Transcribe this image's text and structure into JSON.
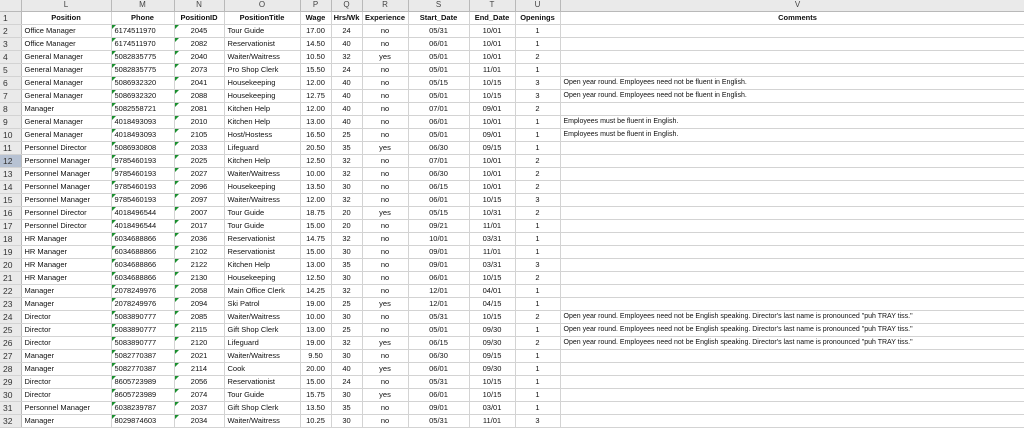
{
  "columns": [
    "L",
    "M",
    "N",
    "O",
    "P",
    "Q",
    "R",
    "S",
    "T",
    "U",
    "V"
  ],
  "headers": [
    "Position",
    "Phone",
    "PositionID",
    "PositionTitle",
    "Wage",
    "Hrs/Wk",
    "Experience",
    "Start_Date",
    "End_Date",
    "Openings",
    "Comments"
  ],
  "selected_row": 12,
  "rows": [
    {
      "num": 2,
      "cells": [
        "Office Manager",
        "6174511970",
        "2045",
        "Tour Guide",
        "17.00",
        "24",
        "no",
        "05/31",
        "10/01",
        "1",
        ""
      ]
    },
    {
      "num": 3,
      "cells": [
        "Office Manager",
        "6174511970",
        "2082",
        "Reservationist",
        "14.50",
        "40",
        "no",
        "06/01",
        "10/01",
        "1",
        ""
      ]
    },
    {
      "num": 4,
      "cells": [
        "General Manager",
        "5082835775",
        "2040",
        "Waiter/Waitress",
        "10.50",
        "32",
        "yes",
        "05/01",
        "10/01",
        "2",
        ""
      ]
    },
    {
      "num": 5,
      "cells": [
        "General Manager",
        "5082835775",
        "2073",
        "Pro Shop Clerk",
        "15.50",
        "24",
        "no",
        "05/01",
        "11/01",
        "1",
        ""
      ]
    },
    {
      "num": 6,
      "cells": [
        "General Manager",
        "5086932320",
        "2041",
        "Housekeeping",
        "12.00",
        "40",
        "no",
        "05/15",
        "10/15",
        "3",
        "Open year round. Employees need not be fluent in English."
      ]
    },
    {
      "num": 7,
      "cells": [
        "General Manager",
        "5086932320",
        "2088",
        "Housekeeping",
        "12.75",
        "40",
        "no",
        "05/01",
        "10/15",
        "3",
        "Open year round. Employees need not be fluent in English."
      ]
    },
    {
      "num": 8,
      "cells": [
        "Manager",
        "5082558721",
        "2081",
        "Kitchen Help",
        "12.00",
        "40",
        "no",
        "07/01",
        "09/01",
        "2",
        ""
      ]
    },
    {
      "num": 9,
      "cells": [
        "General Manager",
        "4018493093",
        "2010",
        "Kitchen Help",
        "13.00",
        "40",
        "no",
        "06/01",
        "10/01",
        "1",
        "Employees must be fluent in English."
      ]
    },
    {
      "num": 10,
      "cells": [
        "General Manager",
        "4018493093",
        "2105",
        "Host/Hostess",
        "16.50",
        "25",
        "no",
        "05/01",
        "09/01",
        "1",
        "Employees must be fluent in English."
      ]
    },
    {
      "num": 11,
      "cells": [
        "Personnel Director",
        "5086930808",
        "2033",
        "Lifeguard",
        "20.50",
        "35",
        "yes",
        "06/30",
        "09/15",
        "1",
        ""
      ]
    },
    {
      "num": 12,
      "cells": [
        "Personnel Manager",
        "9785460193",
        "2025",
        "Kitchen Help",
        "12.50",
        "32",
        "no",
        "07/01",
        "10/01",
        "2",
        ""
      ]
    },
    {
      "num": 13,
      "cells": [
        "Personnel Manager",
        "9785460193",
        "2027",
        "Waiter/Waitress",
        "10.00",
        "32",
        "no",
        "06/30",
        "10/01",
        "2",
        ""
      ]
    },
    {
      "num": 14,
      "cells": [
        "Personnel Manager",
        "9785460193",
        "2096",
        "Housekeeping",
        "13.50",
        "30",
        "no",
        "06/15",
        "10/01",
        "2",
        ""
      ]
    },
    {
      "num": 15,
      "cells": [
        "Personnel Manager",
        "9785460193",
        "2097",
        "Waiter/Waitress",
        "12.00",
        "32",
        "no",
        "06/01",
        "10/15",
        "3",
        ""
      ]
    },
    {
      "num": 16,
      "cells": [
        "Personnel Director",
        "4018496544",
        "2007",
        "Tour Guide",
        "18.75",
        "20",
        "yes",
        "05/15",
        "10/31",
        "2",
        ""
      ]
    },
    {
      "num": 17,
      "cells": [
        "Personnel Director",
        "4018496544",
        "2017",
        "Tour Guide",
        "15.00",
        "20",
        "no",
        "09/21",
        "11/01",
        "1",
        ""
      ]
    },
    {
      "num": 18,
      "cells": [
        "HR Manager",
        "6034688866",
        "2036",
        "Reservationist",
        "14.75",
        "32",
        "no",
        "10/01",
        "03/31",
        "1",
        ""
      ]
    },
    {
      "num": 19,
      "cells": [
        "HR Manager",
        "6034688866",
        "2102",
        "Reservationist",
        "15.00",
        "30",
        "no",
        "09/01",
        "11/01",
        "1",
        ""
      ]
    },
    {
      "num": 20,
      "cells": [
        "HR Manager",
        "6034688866",
        "2122",
        "Kitchen Help",
        "13.00",
        "35",
        "no",
        "09/01",
        "03/31",
        "3",
        ""
      ]
    },
    {
      "num": 21,
      "cells": [
        "HR Manager",
        "6034688866",
        "2130",
        "Housekeeping",
        "12.50",
        "30",
        "no",
        "06/01",
        "10/15",
        "2",
        ""
      ]
    },
    {
      "num": 22,
      "cells": [
        "Manager",
        "2078249976",
        "2058",
        "Main Office Clerk",
        "14.25",
        "32",
        "no",
        "12/01",
        "04/01",
        "1",
        ""
      ]
    },
    {
      "num": 23,
      "cells": [
        "Manager",
        "2078249976",
        "2094",
        "Ski Patrol",
        "19.00",
        "25",
        "yes",
        "12/01",
        "04/15",
        "1",
        ""
      ]
    },
    {
      "num": 24,
      "cells": [
        "Director",
        "5083890777",
        "2085",
        "Waiter/Waitress",
        "10.00",
        "30",
        "no",
        "05/31",
        "10/15",
        "2",
        "Open year round. Employees need not be English speaking. Director's last name is pronounced \"puh TRAY tiss.\""
      ]
    },
    {
      "num": 25,
      "cells": [
        "Director",
        "5083890777",
        "2115",
        "Gift Shop Clerk",
        "13.00",
        "25",
        "no",
        "05/01",
        "09/30",
        "1",
        "Open year round. Employees need not be English speaking. Director's last name is pronounced \"puh TRAY tiss.\""
      ]
    },
    {
      "num": 26,
      "cells": [
        "Director",
        "5083890777",
        "2120",
        "Lifeguard",
        "19.00",
        "32",
        "yes",
        "06/15",
        "09/30",
        "2",
        "Open year round. Employees need not be English speaking. Director's last name is pronounced \"puh TRAY tiss.\""
      ]
    },
    {
      "num": 27,
      "cells": [
        "Manager",
        "5082770387",
        "2021",
        "Waiter/Waitress",
        "9.50",
        "30",
        "no",
        "06/30",
        "09/15",
        "1",
        ""
      ]
    },
    {
      "num": 28,
      "cells": [
        "Manager",
        "5082770387",
        "2114",
        "Cook",
        "20.00",
        "40",
        "yes",
        "06/01",
        "09/30",
        "1",
        ""
      ]
    },
    {
      "num": 29,
      "cells": [
        "Director",
        "8605723989",
        "2056",
        "Reservationist",
        "15.00",
        "24",
        "no",
        "05/31",
        "10/15",
        "1",
        ""
      ]
    },
    {
      "num": 30,
      "cells": [
        "Director",
        "8605723989",
        "2074",
        "Tour Guide",
        "15.75",
        "30",
        "yes",
        "06/01",
        "10/15",
        "1",
        ""
      ]
    },
    {
      "num": 31,
      "cells": [
        "Personnel Manager",
        "6038239787",
        "2037",
        "Gift Shop Clerk",
        "13.50",
        "35",
        "no",
        "09/01",
        "03/01",
        "1",
        ""
      ]
    },
    {
      "num": 32,
      "cells": [
        "Manager",
        "8029874603",
        "2034",
        "Waiter/Waitress",
        "10.25",
        "30",
        "no",
        "05/31",
        "11/01",
        "3",
        ""
      ]
    }
  ]
}
